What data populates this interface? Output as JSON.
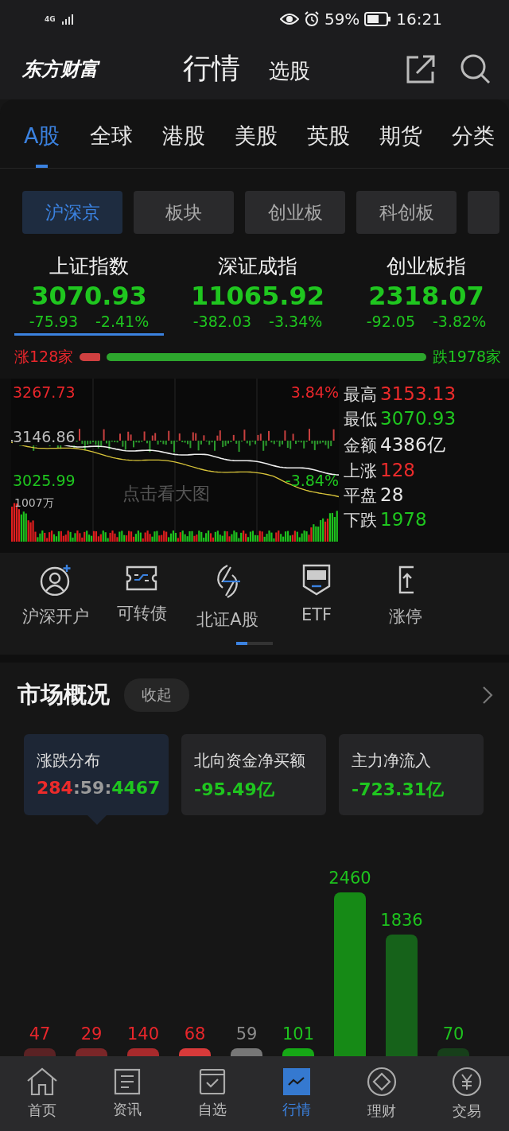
{
  "status_bar": {
    "network": "4G",
    "battery": "59%",
    "time": "16:21"
  },
  "header": {
    "logo": "东方财富",
    "tabs": [
      {
        "label": "行情",
        "selected": true
      },
      {
        "label": "选股",
        "selected": false
      }
    ]
  },
  "market_tabs": [
    {
      "label": "A股",
      "selected": true
    },
    {
      "label": "全球",
      "selected": false
    },
    {
      "label": "港股",
      "selected": false
    },
    {
      "label": "美股",
      "selected": false
    },
    {
      "label": "英股",
      "selected": false
    },
    {
      "label": "期货",
      "selected": false
    },
    {
      "label": "分类",
      "selected": false
    }
  ],
  "chips": [
    {
      "label": "沪深京",
      "selected": true
    },
    {
      "label": "板块",
      "selected": false
    },
    {
      "label": "创业板",
      "selected": false
    },
    {
      "label": "科创板",
      "selected": false
    }
  ],
  "indices": [
    {
      "name": "上证指数",
      "value": "3070.93",
      "change": "-75.93",
      "percent": "-2.41%",
      "selected": true
    },
    {
      "name": "深证成指",
      "value": "11065.92",
      "change": "-382.03",
      "percent": "-3.34%",
      "selected": false
    },
    {
      "name": "创业板指",
      "value": "2318.07",
      "change": "-92.05",
      "percent": "-3.82%",
      "selected": false
    }
  ],
  "breadth": {
    "up_label": "涨128家",
    "down_label": "跌1978家"
  },
  "intraday": {
    "high_price": "3267.73",
    "high_pct": "3.84%",
    "prev_close": "3146.86",
    "low_price": "3025.99",
    "low_pct": "-3.84%",
    "volume": "1007万",
    "hint": "点击看大图",
    "stats": [
      {
        "label": "最高",
        "value": "3153.13",
        "color": "#ec2b2b"
      },
      {
        "label": "最低",
        "value": "3070.93",
        "color": "#1fc61f"
      },
      {
        "label": "金额",
        "value": "4386亿",
        "color": "#e6e6e6"
      },
      {
        "label": "上涨",
        "value": "128",
        "color": "#ec2b2b"
      },
      {
        "label": "平盘",
        "value": "28",
        "color": "#e6e6e6"
      },
      {
        "label": "下跌",
        "value": "1978",
        "color": "#1fc61f"
      }
    ]
  },
  "shortcuts": {
    "items": [
      {
        "label": "沪深开户",
        "kind": "account"
      },
      {
        "label": "可转债",
        "kind": "bond"
      },
      {
        "label": "北证A股",
        "kind": "bolt"
      },
      {
        "label": "ETF",
        "kind": "etf"
      },
      {
        "label": "涨停",
        "kind": "limit"
      }
    ]
  },
  "overview": {
    "title": "市场概况",
    "collapse": "收起",
    "cards": [
      {
        "title": "涨跌分布",
        "selected": true,
        "parts": [
          {
            "text": "284",
            "color": "#ec2b2b"
          },
          {
            "text": ":",
            "color": "#9a9a9a"
          },
          {
            "text": "59",
            "color": "#9a9a9a"
          },
          {
            "text": ":",
            "color": "#9a9a9a"
          },
          {
            "text": "4467",
            "color": "#1fc61f"
          }
        ]
      },
      {
        "title": "北向资金净买额",
        "selected": false,
        "parts": [
          {
            "text": "-95.49亿",
            "color": "#1fc61f"
          }
        ]
      },
      {
        "title": "主力净流入",
        "selected": false,
        "parts": [
          {
            "text": "-723.31亿",
            "color": "#1fc61f"
          }
        ]
      }
    ],
    "distribution": [
      {
        "count": "47",
        "color": "#5a2224"
      },
      {
        "count": "29",
        "color": "#7a2628"
      },
      {
        "count": "140",
        "color": "#a82a2c"
      },
      {
        "count": "68",
        "color": "#d83a3a"
      },
      {
        "count": "59",
        "color": "#777777"
      },
      {
        "count": "101",
        "color": "#16a816"
      },
      {
        "count": "2460",
        "color": "#168a16"
      },
      {
        "count": "1836",
        "color": "#16621a"
      },
      {
        "count": "70",
        "color": "#173f1a"
      }
    ]
  },
  "bottom_nav": [
    {
      "label": "首页",
      "kind": "home",
      "selected": false
    },
    {
      "label": "资讯",
      "kind": "news",
      "selected": false
    },
    {
      "label": "自选",
      "kind": "watch",
      "selected": false
    },
    {
      "label": "行情",
      "kind": "market",
      "selected": true
    },
    {
      "label": "理财",
      "kind": "wealth",
      "selected": false
    },
    {
      "label": "交易",
      "kind": "trade",
      "selected": false
    }
  ]
}
